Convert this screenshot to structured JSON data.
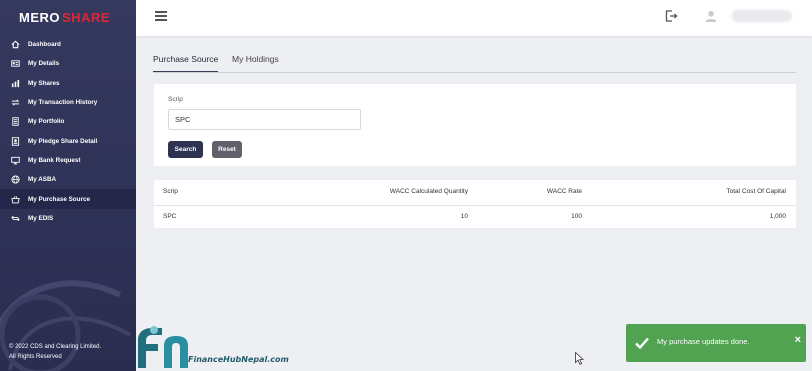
{
  "sidebar": {
    "logo_part1": "MERO",
    "logo_part2": "SHARE",
    "items": [
      {
        "label": "Dashboard",
        "icon": "home-icon"
      },
      {
        "label": "My Details",
        "icon": "id-card-icon"
      },
      {
        "label": "My Shares",
        "icon": "bar-chart-icon"
      },
      {
        "label": "My Transaction History",
        "icon": "transfer-icon"
      },
      {
        "label": "My Portfolio",
        "icon": "document-icon"
      },
      {
        "label": "My Pledge Share Detail",
        "icon": "pledge-icon"
      },
      {
        "label": "My Bank Request",
        "icon": "monitor-icon"
      },
      {
        "label": "My ASBA",
        "icon": "globe-icon"
      },
      {
        "label": "My Purchase Source",
        "icon": "basket-icon",
        "active": true
      },
      {
        "label": "My EDIS",
        "icon": "swap-icon"
      }
    ],
    "footer_line1": "© 2022 CDS and Clearing Limited.",
    "footer_line2": "All Rights Reserved"
  },
  "tabs": [
    {
      "label": "Purchase Source",
      "active": true
    },
    {
      "label": "My Holdings",
      "active": false
    }
  ],
  "filter": {
    "label": "Scrip",
    "value": "SPC",
    "search_label": "Search",
    "reset_label": "Reset"
  },
  "table": {
    "columns": [
      "Scrip",
      "WACC Calculated Quantity",
      "WACC Rate",
      "Total Cost Of Capital"
    ],
    "rows": [
      {
        "scrip": "SPC",
        "quantity": "10",
        "rate": "100",
        "total": "1,000"
      }
    ]
  },
  "toast": {
    "message": "My purchase updates done.",
    "close": "×",
    "color": "#51a351"
  },
  "watermark": {
    "text": "FinanceHubNepal.com"
  },
  "colors": {
    "sidebar": "#36395e",
    "accent_red": "#d9283a",
    "search_button": "#2f3352",
    "reset_button": "#60616a"
  }
}
